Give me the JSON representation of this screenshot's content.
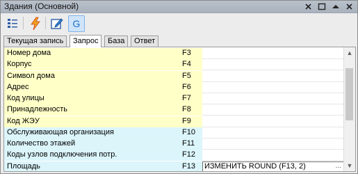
{
  "window": {
    "title": "Здания (Основной)"
  },
  "titlebar_buttons": [
    {
      "name": "close",
      "glyph": "✕"
    },
    {
      "name": "maximize",
      "glyph": "□"
    },
    {
      "name": "collapse",
      "glyph": "▲"
    },
    {
      "name": "close2",
      "glyph": "✕"
    }
  ],
  "toolbar": {
    "tools": [
      {
        "name": "list-view",
        "icon": "list-icon"
      },
      {
        "name": "lightning",
        "icon": "lightning-icon"
      },
      {
        "name": "edit",
        "icon": "edit-icon"
      },
      {
        "name": "g-mode",
        "icon": "g-icon",
        "label": "G"
      }
    ]
  },
  "tabs": [
    {
      "label": "Текущая запись"
    },
    {
      "label": "Запрос"
    },
    {
      "label": "База"
    },
    {
      "label": "Ответ"
    }
  ],
  "selected_tab": "Запрос",
  "rows": [
    {
      "name": "Номер дома",
      "code": "F3",
      "color": "yellow"
    },
    {
      "name": "Корпус",
      "code": "F4",
      "color": "yellow"
    },
    {
      "name": "Символ дома",
      "code": "F5",
      "color": "yellow"
    },
    {
      "name": "Адрес",
      "code": "F6",
      "color": "yellow"
    },
    {
      "name": "Код улицы",
      "code": "F7",
      "color": "yellow"
    },
    {
      "name": "Принадлежность",
      "code": "F8",
      "color": "yellow"
    },
    {
      "name": "Код ЖЭУ",
      "code": "F9",
      "color": "yellow"
    },
    {
      "name": "Обслуживающая организация",
      "code": "F10",
      "color": "cyan"
    },
    {
      "name": "Количество этажей",
      "code": "F11",
      "color": "cyan"
    },
    {
      "name": "Коды узлов подключения потр.",
      "code": "F12",
      "color": "cyan"
    },
    {
      "name": "Площадь",
      "code": "F13",
      "color": "cyan",
      "value": "ИЗМЕНИТЬ ROUND (F13, 2)",
      "editing": true,
      "dots": "..."
    }
  ],
  "scrollbar": {
    "up": "▲",
    "down": "▼"
  }
}
